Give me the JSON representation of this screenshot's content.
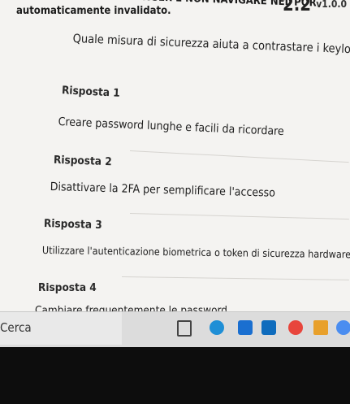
{
  "header": {
    "warning_line1": "automaticamente invalidato.",
    "warning_line2": "IL BROWSER E NON NAVIGARE NEL POR",
    "stamp": "2.2",
    "version": "v1.0.0"
  },
  "question": {
    "text": "Quale misura di sicurezza aiuta a contrastare i keylogger?"
  },
  "answers": [
    {
      "label": "Risposta 1",
      "text": "Creare password lunghe e facili da ricordare"
    },
    {
      "label": "Risposta 2",
      "text": "Disattivare la 2FA per semplificare l'accesso"
    },
    {
      "label": "Risposta 3",
      "text": "Utilizzare l'autenticazione biometrica o token di sicurezza hardware"
    },
    {
      "label": "Risposta 4",
      "text": "Cambiare frequentemente le password"
    }
  ],
  "taskbar": {
    "search_label": "Cerca",
    "icons": [
      "task-view-icon",
      "edge-icon",
      "store-icon",
      "outlook-icon",
      "chrome-icon",
      "pinned-app-icon",
      "chrome-alt-icon"
    ],
    "colors": {
      "edge": "#1f8fd6",
      "store": "#1a6fd0",
      "outlook": "#0f6cbd",
      "chrome": "#e8453c",
      "pinned": "#e8a02b",
      "chrome_alt": "#4a8df0"
    }
  }
}
